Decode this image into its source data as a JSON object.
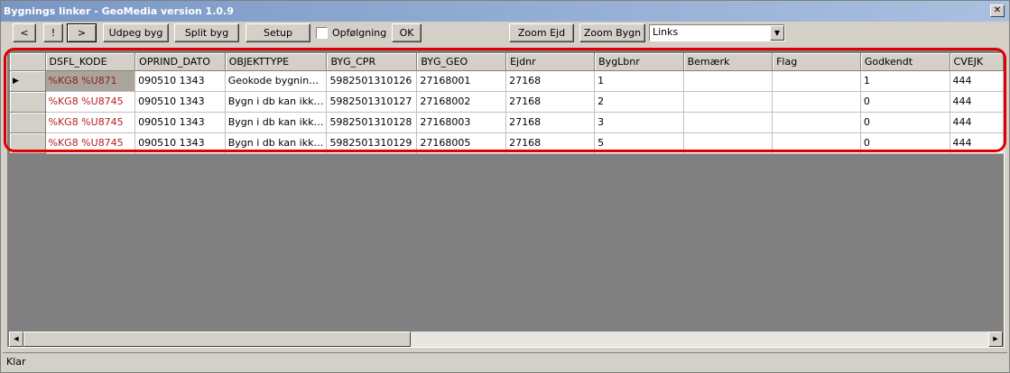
{
  "window": {
    "title": "Bygnings linker - GeoMedia version 1.0.9",
    "close_glyph": "✕"
  },
  "toolbar": {
    "prev_label": "<",
    "excl_label": "!",
    "next_label": ">",
    "udpeg_label": "Udpeg byg",
    "split_label": "Split byg",
    "setup_label": "Setup",
    "opfolgning_label": "Opfølgning",
    "ok_label": "OK",
    "zoom_ejd_label": "Zoom Ejd",
    "zoom_bygn_label": "Zoom Bygn",
    "links_value": "Links",
    "dropdown_glyph": "▼"
  },
  "grid": {
    "columns": [
      "DSFL_KODE",
      "OPRIND_DATO",
      "OBJEKTTYPE",
      "BYG_CPR",
      "BYG_GEO",
      "Ejdnr",
      "BygLbnr",
      "Bemærk",
      "Flag",
      "Godkendt",
      "CVEJK"
    ],
    "current_row_marker": "▶",
    "rows": [
      [
        "%KG8 %U871",
        "090510 1343",
        "Geokode bygnin…",
        "5982501310126",
        "27168001",
        "27168",
        "1",
        "",
        "",
        "1",
        "444"
      ],
      [
        "%KG8 %U8745",
        "090510 1343",
        "Bygn i db kan ikk…",
        "5982501310127",
        "27168002",
        "27168",
        "2",
        "",
        "",
        "0",
        "444"
      ],
      [
        "%KG8 %U8745",
        "090510 1343",
        "Bygn i db kan ikk…",
        "5982501310128",
        "27168003",
        "27168",
        "3",
        "",
        "",
        "0",
        "444"
      ],
      [
        "%KG8 %U8745",
        "090510 1343",
        "Bygn i db kan ikk…",
        "5982501310129",
        "27168005",
        "27168",
        "5",
        "",
        "",
        "0",
        "444"
      ]
    ]
  },
  "scrollbar": {
    "left_glyph": "◀",
    "right_glyph": "▶"
  },
  "status": {
    "text": "Klar"
  },
  "colors": {
    "highlight": "#e00000",
    "kode_text": "#b22222",
    "title_bar": "#7a97c4"
  }
}
